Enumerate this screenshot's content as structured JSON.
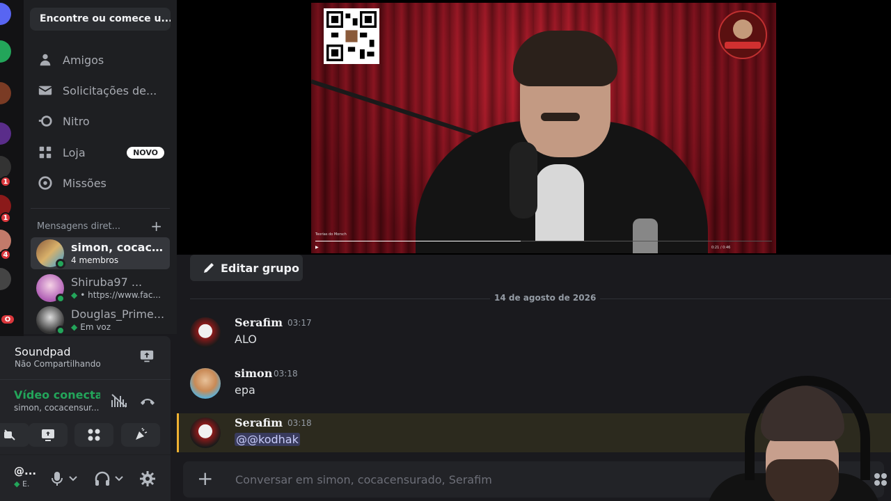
{
  "sidebar": {
    "search_label": "Encontre ou comece u...",
    "nav": [
      {
        "label": "Amigos",
        "icon": "friends-icon"
      },
      {
        "label": "Solicitações de...",
        "icon": "envelope-icon"
      },
      {
        "label": "Nitro",
        "icon": "nitro-icon"
      },
      {
        "label": "Loja",
        "icon": "shop-icon",
        "badge": "NOVO"
      },
      {
        "label": "Missões",
        "icon": "quests-icon"
      }
    ],
    "dm_header": "Mensagens diret...",
    "dms": [
      {
        "name": "simon, cocacen...",
        "sub": "4 membros"
      },
      {
        "name": "Shiruba97 ...",
        "sub": "• https://www.fac..."
      },
      {
        "name": "Douglas_Prime...",
        "sub": "Em voz"
      }
    ]
  },
  "server_rail": {
    "badges": [
      "1",
      "1",
      "4",
      "O"
    ]
  },
  "panel": {
    "app_name": "Soundpad",
    "app_status": "Não Compartilhando",
    "voice_status": "Vídeo conectac",
    "voice_channel": "simon, cocacensur...",
    "user_name": "@...",
    "user_status": "E."
  },
  "video": {
    "title": "Teorias do Morsch",
    "time": "0:21 / 0:46",
    "progress": 0.45
  },
  "chat": {
    "edit_group_label": "Editar grupo",
    "date": "14 de agosto de 2026",
    "messages": [
      {
        "author": "Serafim",
        "time": "03:17",
        "text": "ALO"
      },
      {
        "author": "simon",
        "time": "03:18",
        "text": "epa"
      },
      {
        "author": "Serafim",
        "time": "03:18",
        "text": "@@kodhak"
      }
    ],
    "composer_placeholder": "Conversar em simon, cocacensurado, Serafim"
  },
  "colors": {
    "accent_green": "#23a55a",
    "mention_bg": "#5865f2",
    "highlight_bar": "#f0b232",
    "badge_red": "#da373c"
  }
}
